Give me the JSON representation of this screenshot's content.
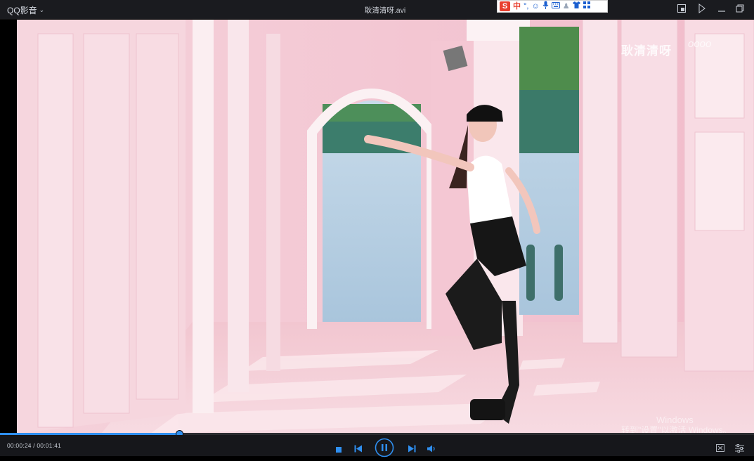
{
  "app": {
    "name": "QQ影音"
  },
  "window": {
    "title": "耿清清呀.avi"
  },
  "ime": {
    "brand": "S",
    "mode": "中",
    "icons": [
      "punctuation-icon",
      "emoji-icon",
      "microphone-icon",
      "keyboard-icon",
      "user-icon",
      "skin-icon",
      "toolbox-icon"
    ]
  },
  "video": {
    "watermark": "耿清清呀",
    "watermark_sub": "oooo",
    "activate_line1": "Windows",
    "activate_line2": "转到\"设置\"以激活 Windows。"
  },
  "player": {
    "current_time": "00:00:24",
    "total_time": "00:01:41",
    "time_display": "00:00:24 / 00:01:41",
    "progress": 0.238,
    "accent_color": "#2f8ff0"
  }
}
